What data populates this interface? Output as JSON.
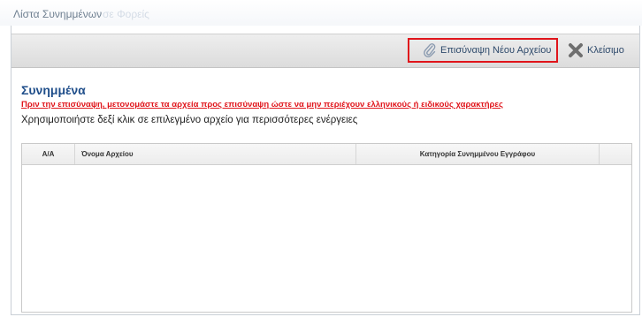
{
  "window": {
    "title": "Λίστα Συνημμένων",
    "title_ghost": "σε Φορείς"
  },
  "toolbar": {
    "attach_label": "Επισύναψη Νέου Αρχείου",
    "close_label": "Κλείσιμο",
    "attach_icon": "paperclip-icon",
    "close_icon": "close-x-icon"
  },
  "content": {
    "section_title": "Συνημμένα",
    "warning": "Πριν την επισύναψη, μετονομάστε τα αρχεία προς επισύναψη ώστε να μην περιέχουν ελληνικούς ή ειδικούς χαρακτήρες",
    "hint": "Χρησιμοποιήστε δεξί κλικ σε επιλεγμένο αρχείο για περισσότερες ενέργειες"
  },
  "table": {
    "columns": [
      "Α/Α",
      "Όνομα Αρχείου",
      "Κατηγορία Συνημμένου Εγγράφου",
      ""
    ],
    "rows": []
  },
  "colors": {
    "accent_red": "#e0151b",
    "title_blue": "#1f4e8a"
  }
}
